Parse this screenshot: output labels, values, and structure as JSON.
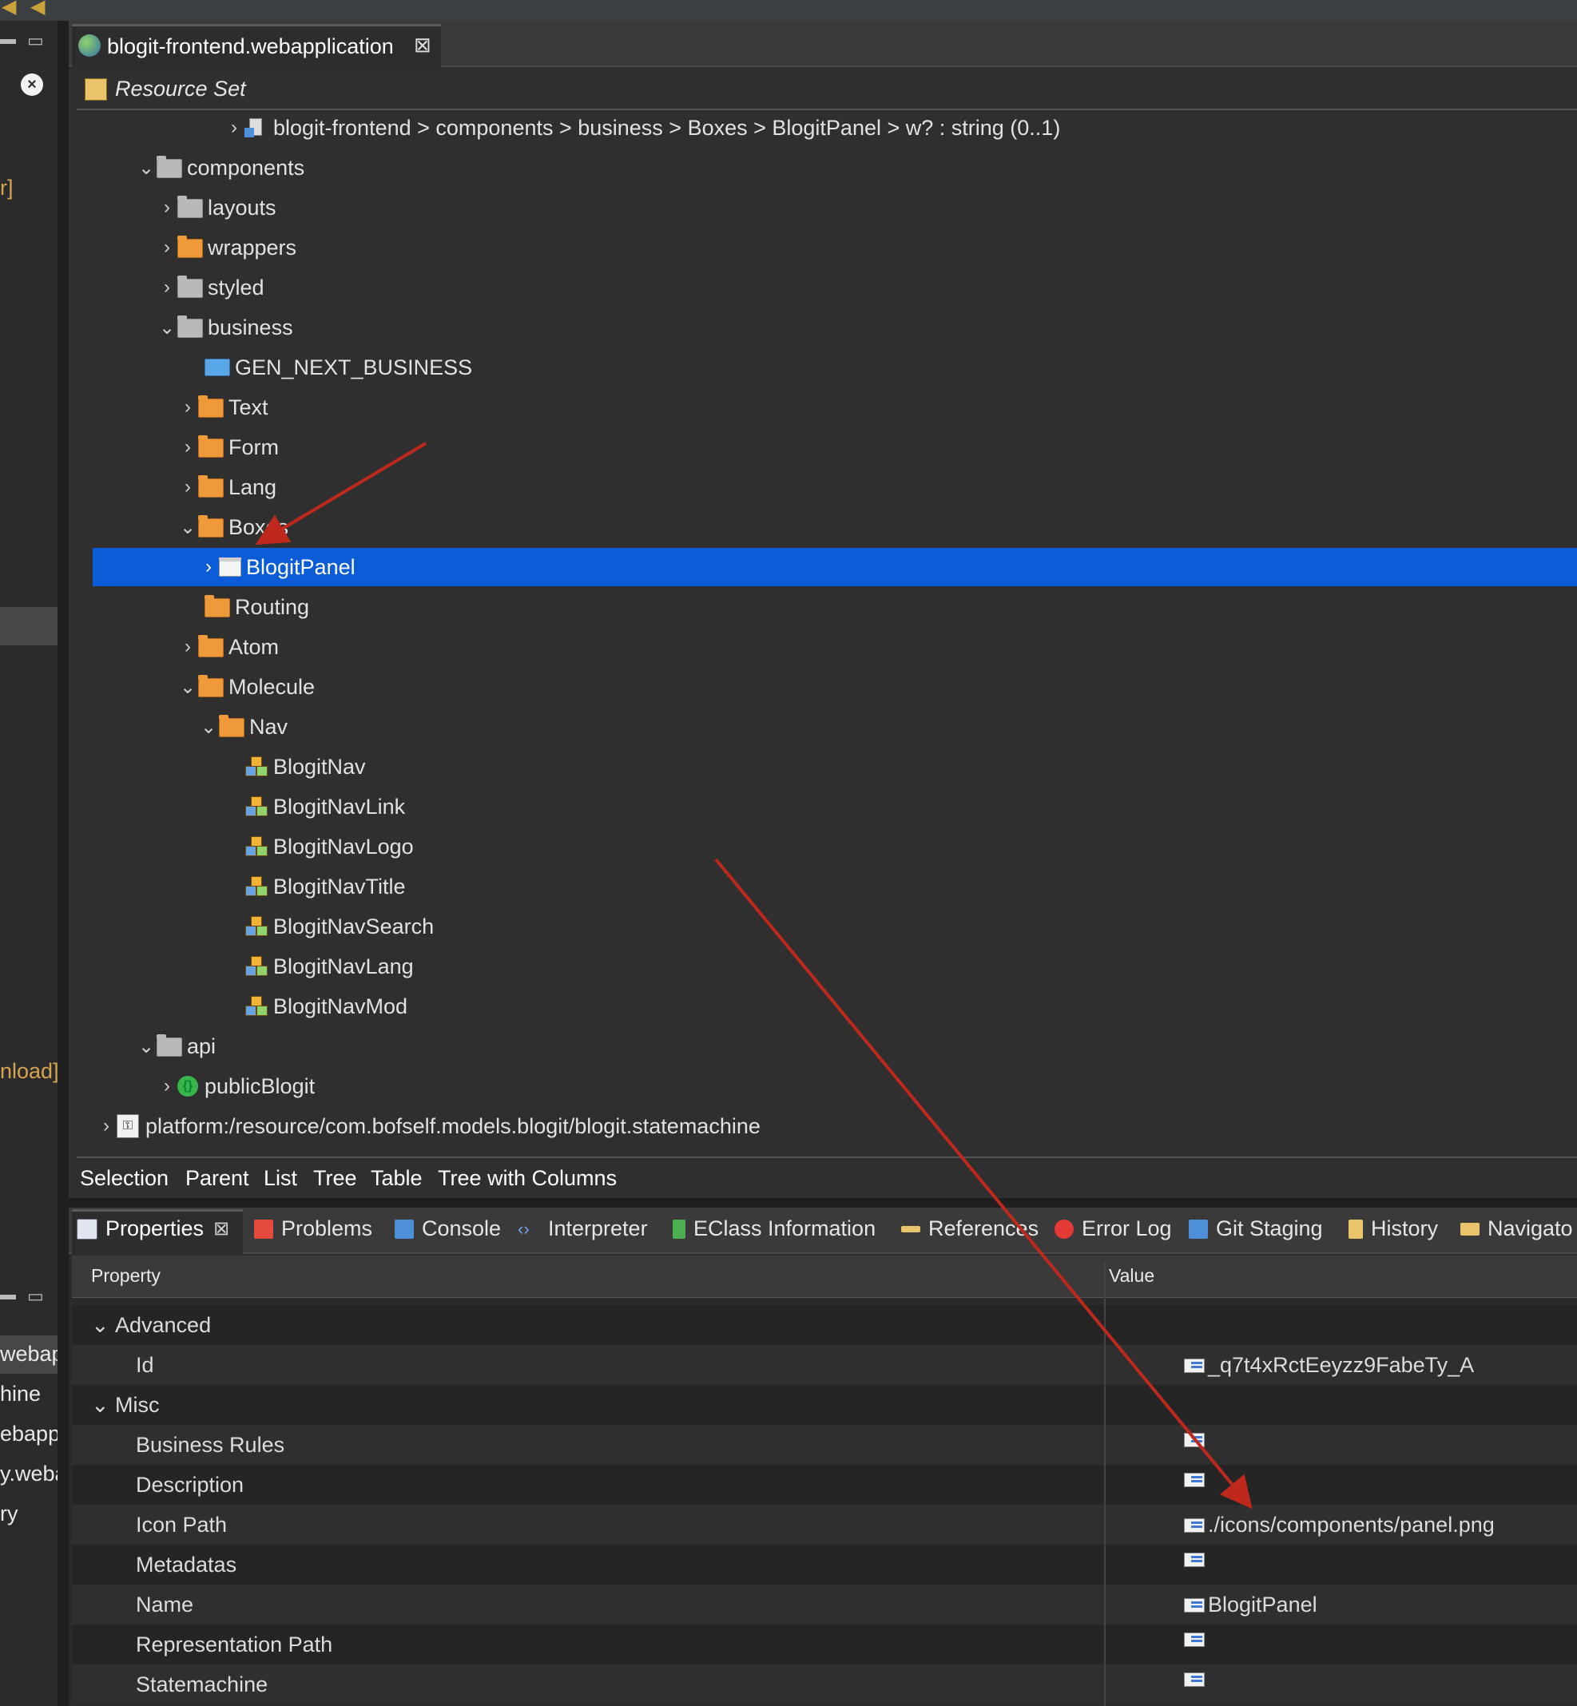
{
  "editor": {
    "tab_title": "blogit-frontend.webapplication",
    "resource_set_label": "Resource Set",
    "view_modes": [
      "Selection",
      "Parent",
      "List",
      "Tree",
      "Table",
      "Tree with Columns"
    ]
  },
  "tree": {
    "path_item": "blogit-frontend > components > business > Boxes > BlogitPanel > w? : string (0..1)",
    "items": [
      {
        "label": "components",
        "icon": "grey-folder-icon",
        "expanded": true
      },
      {
        "label": "layouts",
        "icon": "grey-folder-icon",
        "expanded": false
      },
      {
        "label": "wrappers",
        "icon": "orange-folder-icon",
        "expanded": false
      },
      {
        "label": "styled",
        "icon": "grey-folder-icon",
        "expanded": false
      },
      {
        "label": "business",
        "icon": "grey-folder-icon",
        "expanded": true
      },
      {
        "label": "GEN_NEXT_BUSINESS",
        "icon": "generated-folder-icon"
      },
      {
        "label": "Text",
        "icon": "orange-folder-icon",
        "expanded": false
      },
      {
        "label": "Form",
        "icon": "orange-folder-icon",
        "expanded": false
      },
      {
        "label": "Lang",
        "icon": "orange-folder-icon",
        "expanded": false
      },
      {
        "label": "Boxes",
        "icon": "orange-folder-icon",
        "expanded": true
      },
      {
        "label": "BlogitPanel",
        "icon": "panel-icon",
        "selected": true
      },
      {
        "label": "Routing",
        "icon": "orange-folder-icon"
      },
      {
        "label": "Atom",
        "icon": "orange-folder-icon",
        "expanded": false
      },
      {
        "label": "Molecule",
        "icon": "orange-folder-icon",
        "expanded": true
      },
      {
        "label": "Nav",
        "icon": "orange-folder-icon",
        "expanded": true
      },
      {
        "label": "BlogitNav",
        "icon": "component-icon"
      },
      {
        "label": "BlogitNavLink",
        "icon": "component-icon"
      },
      {
        "label": "BlogitNavLogo",
        "icon": "component-icon"
      },
      {
        "label": "BlogitNavTitle",
        "icon": "component-icon"
      },
      {
        "label": "BlogitNavSearch",
        "icon": "component-icon"
      },
      {
        "label": "BlogitNavLang",
        "icon": "component-icon"
      },
      {
        "label": "BlogitNavMod",
        "icon": "component-icon"
      },
      {
        "label": "api",
        "icon": "grey-folder-icon",
        "expanded": true
      },
      {
        "label": "publicBlogit",
        "icon": "api-icon",
        "expanded": false
      },
      {
        "label": "platform:/resource/com.bofself.models.blogit/blogit.statemachine",
        "icon": "resource-icon",
        "expanded": false
      }
    ]
  },
  "left_panel": {
    "fragments": [
      "r]",
      "nload]",
      "webap",
      "hine",
      "ebapp",
      "y.weba",
      "ry"
    ]
  },
  "bottom_tabs": [
    {
      "label": "Properties",
      "icon": "properties-icon",
      "active": true
    },
    {
      "label": "Problems",
      "icon": "problems-icon"
    },
    {
      "label": "Console",
      "icon": "console-icon"
    },
    {
      "label": "Interpreter",
      "icon": "interpreter-icon"
    },
    {
      "label": "EClass Information",
      "icon": "eclass-icon"
    },
    {
      "label": "References",
      "icon": "references-icon"
    },
    {
      "label": "Error Log",
      "icon": "error-log-icon"
    },
    {
      "label": "Git Staging",
      "icon": "git-staging-icon"
    },
    {
      "label": "History",
      "icon": "history-icon"
    },
    {
      "label": "Navigato",
      "icon": "navigator-icon"
    }
  ],
  "properties": {
    "col_property": "Property",
    "col_value": "Value",
    "rows": [
      {
        "name": "Advanced",
        "category": true
      },
      {
        "name": "Id",
        "value": "_q7t4xRctEeyzz9FabeTy_A"
      },
      {
        "name": "Misc",
        "category": true
      },
      {
        "name": "Business Rules",
        "value": ""
      },
      {
        "name": "Description",
        "value": ""
      },
      {
        "name": "Icon Path",
        "value": "./icons/components/panel.png"
      },
      {
        "name": "Metadatas",
        "value": ""
      },
      {
        "name": "Name",
        "value": "BlogitPanel"
      },
      {
        "name": "Representation Path",
        "value": ""
      },
      {
        "name": "Statemachine",
        "value": ""
      }
    ]
  },
  "colors": {
    "selection": "#0b5cd6",
    "arrow": "#c0281c",
    "orange_folder": "#ee9a3a"
  }
}
